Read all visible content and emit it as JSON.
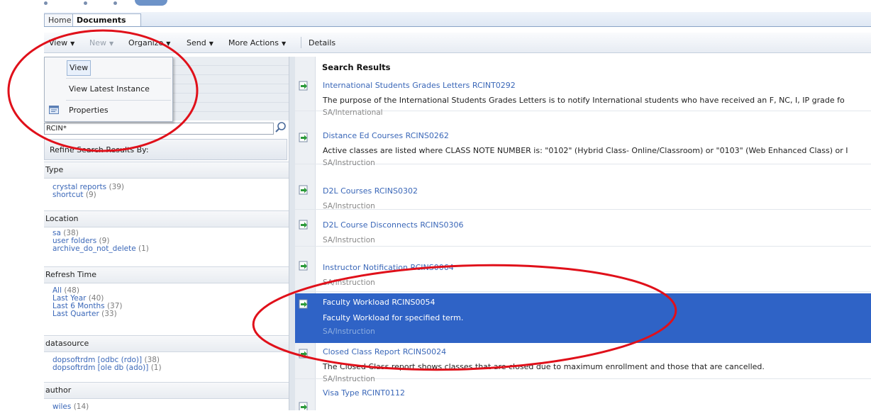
{
  "tabs": {
    "home": "Home",
    "documents": "Documents"
  },
  "toolbar": {
    "view": "View",
    "new": "New",
    "organize": "Organize",
    "send": "Send",
    "more_actions": "More Actions",
    "details": "Details"
  },
  "view_menu": {
    "items": [
      "View",
      "View Latest Instance",
      "Properties"
    ]
  },
  "search": {
    "value": "RCIN*"
  },
  "refine_title": "Refine Search Results By:",
  "facets": {
    "type": {
      "title": "Type",
      "items": [
        {
          "label": "crystal reports",
          "count": "(39)"
        },
        {
          "label": "shortcut",
          "count": "(9)"
        }
      ]
    },
    "location": {
      "title": "Location",
      "items": [
        {
          "label": "sa",
          "count": "(38)"
        },
        {
          "label": "user folders",
          "count": "(9)"
        },
        {
          "label": "archive_do_not_delete",
          "count": "(1)"
        }
      ]
    },
    "refresh": {
      "title": "Refresh Time",
      "items": [
        {
          "label": "All",
          "count": "(48)"
        },
        {
          "label": "Last Year",
          "count": "(40)"
        },
        {
          "label": "Last 6 Months",
          "count": "(37)"
        },
        {
          "label": "Last Quarter",
          "count": "(33)"
        }
      ]
    },
    "datasource": {
      "title": "datasource",
      "items": [
        {
          "label": "dopsoftrdm [odbc (rdo)]",
          "count": "(38)"
        },
        {
          "label": "dopsoftrdm [ole db (ado)]",
          "count": "(1)"
        }
      ]
    },
    "author": {
      "title": "author",
      "items": [
        {
          "label": "wiles",
          "count": "(14)"
        }
      ]
    }
  },
  "results": {
    "header": "Search Results",
    "rows": [
      {
        "title": "International Students Grades Letters RCINT0292",
        "desc": "The purpose of the International Students Grades Letters is to notify International students who have received an F, NC, I, IP grade fo",
        "path": "SA/International"
      },
      {
        "title": "Distance Ed Courses RCINS0262",
        "desc": "Active classes are listed where CLASS NOTE NUMBER is: \"0102\" (Hybrid Class- Online/Classroom) or \"0103\" (Web Enhanced Class) or I",
        "path": "SA/Instruction"
      },
      {
        "title": "D2L Courses RCINS0302",
        "desc": "",
        "path": "SA/Instruction"
      },
      {
        "title": "D2L Course Disconnects RCINS0306",
        "desc": "",
        "path": "SA/Instruction"
      },
      {
        "title": "Instructor Notification RCINS0064",
        "desc": "",
        "path": "SA/Instruction"
      },
      {
        "title": "Faculty Workload RCINS0054",
        "desc": "Faculty Workload for specified term.",
        "path": "SA/Instruction"
      },
      {
        "title": "Closed Class Report RCINS0024",
        "desc": "The Closed Class report shows classes that are closed due to maximum enrollment and those that are cancelled.",
        "path": "SA/Instruction"
      },
      {
        "title": "Visa Type RCINT0112",
        "desc": "",
        "path": ""
      }
    ]
  },
  "colors": {
    "selection": "#2f63c6",
    "link": "#3a67b8",
    "annotation": "#e0101a"
  }
}
